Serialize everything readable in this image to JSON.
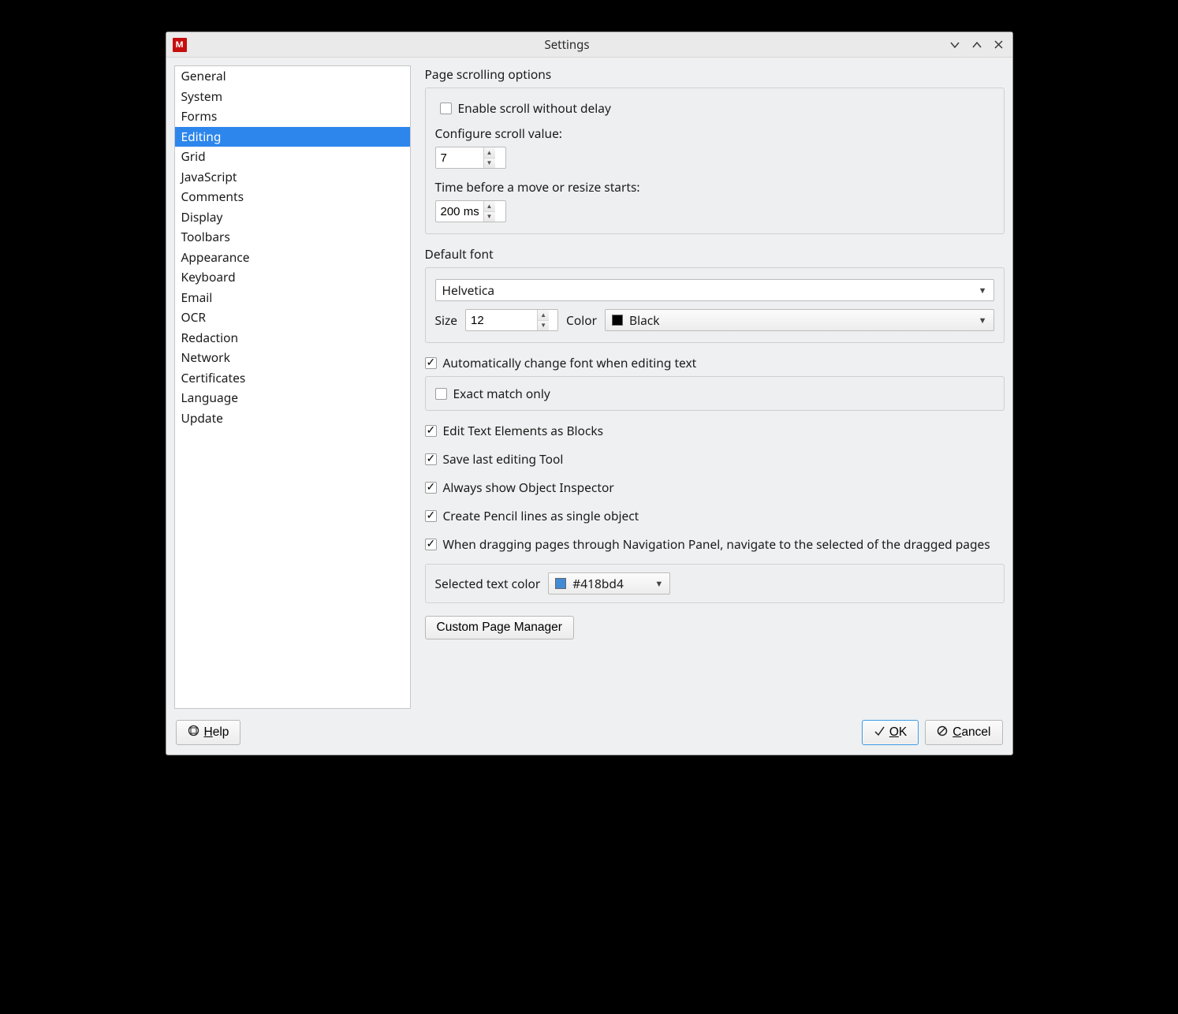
{
  "window": {
    "title": "Settings"
  },
  "sidebar": {
    "items": [
      "General",
      "System",
      "Forms",
      "Editing",
      "Grid",
      "JavaScript",
      "Comments",
      "Display",
      "Toolbars",
      "Appearance",
      "Keyboard",
      "Email",
      "OCR",
      "Redaction",
      "Network",
      "Certificates",
      "Language",
      "Update"
    ],
    "selected": "Editing"
  },
  "scroll": {
    "section_title": "Page scrolling options",
    "enable_label": "Enable scroll without delay",
    "enable_checked": false,
    "configure_label": "Configure scroll value:",
    "configure_value": "7",
    "delay_label": "Time before a move or resize starts:",
    "delay_value": "200 ms"
  },
  "font": {
    "section_title": "Default font",
    "family": "Helvetica",
    "size_label": "Size",
    "size_value": "12",
    "color_label": "Color",
    "color_name": "Black",
    "color_hex": "#000000"
  },
  "auto_font": {
    "auto_label": "Automatically change font when editing text",
    "auto_checked": true,
    "exact_label": "Exact match only",
    "exact_checked": false
  },
  "flags": [
    {
      "label": "Edit Text Elements as Blocks",
      "checked": true
    },
    {
      "label": "Save last editing Tool",
      "checked": true
    },
    {
      "label": "Always show Object Inspector",
      "checked": true
    },
    {
      "label": "Create Pencil lines as single object",
      "checked": true
    },
    {
      "label": "When dragging pages through Navigation Panel, navigate to the selected of the dragged pages",
      "checked": true
    }
  ],
  "sel_color": {
    "label": "Selected text color",
    "value": "#418bd4"
  },
  "custom_btn": "Custom Page Manager",
  "footer": {
    "help": "Help",
    "ok": "OK",
    "cancel": "Cancel"
  }
}
